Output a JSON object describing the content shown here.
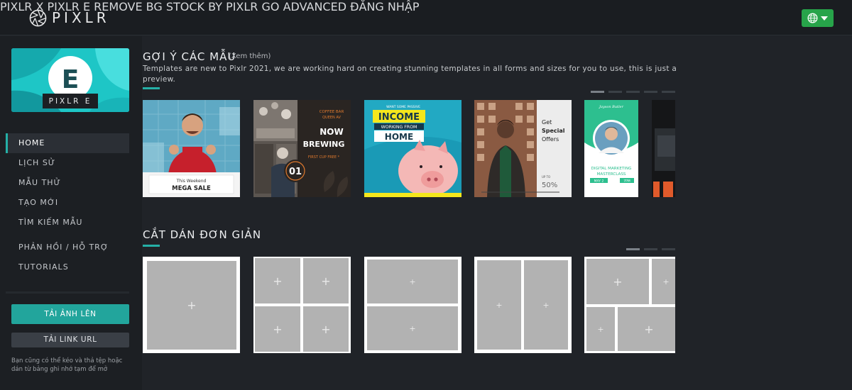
{
  "brand": {
    "name": "PIXLR"
  },
  "nav": {
    "items": [
      {
        "label": "PIXLR X"
      },
      {
        "label": "PIXLR E"
      },
      {
        "label": "REMOVE BG"
      },
      {
        "label": "STOCK BY PIXLR"
      },
      {
        "label": "GO ADVANCED"
      },
      {
        "label": "ĐĂNG NHẬP"
      }
    ]
  },
  "sidebar": {
    "app_letter": "E",
    "app_name": "PIXLR E",
    "menu": [
      {
        "label": "HOME",
        "active": true
      },
      {
        "label": "LỊCH SỬ"
      },
      {
        "label": "MẪU THỬ"
      },
      {
        "label": "TẠO MỚI"
      },
      {
        "label": "TÌM KIẾM MẪU"
      },
      {
        "label": "PHẢN HỒI / HỖ TRỢ"
      },
      {
        "label": "TUTORIALS"
      }
    ],
    "upload_label": "TẢI ẢNH LÊN",
    "url_label": "TẢI LINK URL",
    "hint": "Bạn cũng có thể kéo và thả tệp hoặc dán từ bảng ghi nhớ tạm để mở"
  },
  "templates": {
    "title": "GỢI Ý CÁC MẪU",
    "see_more": "(Xem thêm)",
    "description": "Templates are new to Pixlr 2021, we are working hard on creating stunning templates in all forms and sizes for you to use, this is just a preview.",
    "cards": [
      {
        "line1": "This Weekend",
        "line2": "MEGA SALE"
      },
      {
        "top": "COFFEE BAR",
        "sub": "QUEEN AV",
        "headline1": "NOW",
        "headline2": "BREWING",
        "tag": "FIRST CUP FREE *",
        "number": "01"
      },
      {
        "top": "WANT SOME PASSIVE",
        "headline1": "INCOME",
        "headline2": "WORKING FROM",
        "headline3": "HOME"
      },
      {
        "line1": "Get",
        "line2": "Special",
        "line3": "Offers",
        "upto": "UP TO",
        "percent": "50%"
      },
      {
        "name": "Jayson Butler",
        "line1": "DIGITAL MARKETING",
        "line2": "MASTERCLASS",
        "date": "MAY 2",
        "time": "7PM"
      }
    ]
  },
  "collage": {
    "title": "CẮT DÁN ĐƠN GIẢN",
    "plus": "+"
  },
  "colors": {
    "accent": "#25b0a7",
    "green": "#27a44a",
    "bg": "#202328"
  }
}
